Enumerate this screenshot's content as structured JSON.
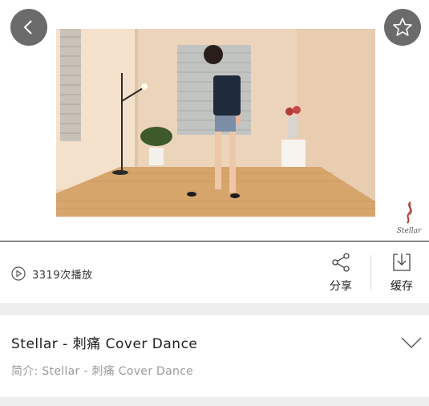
{
  "player": {
    "back_icon": "chevron-left-icon",
    "favorite_icon": "star-icon",
    "watermark_text": "Stellar"
  },
  "stats": {
    "play_icon": "play-circle-icon",
    "play_count": "3319次播放"
  },
  "actions": {
    "share_label": "分享",
    "share_icon": "share-icon",
    "cache_label": "缓存",
    "cache_icon": "download-icon"
  },
  "video_info": {
    "title": "Stellar - 刺痛 Cover Dance",
    "description": "简介: Stellar - 刺痛 Cover Dance",
    "expand_icon": "chevron-down-icon"
  },
  "colors": {
    "overlay_button": "#6b6b6b",
    "divider": "#1a1a1a",
    "band": "#eeeeee",
    "description_text": "#9a9a9a"
  }
}
